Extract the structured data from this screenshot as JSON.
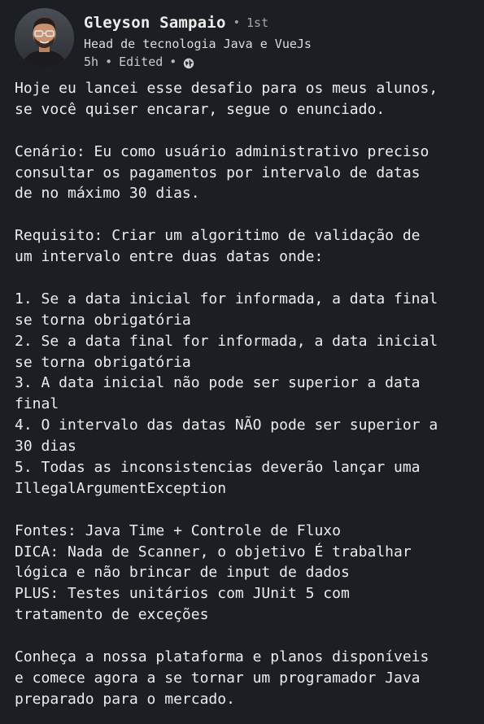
{
  "author": {
    "name": "Gleyson Sampaio",
    "degree": "1st",
    "headline": "Head de tecnologia Java e VueJs",
    "time": "5h",
    "edited": "Edited",
    "visibility_icon": "globe-icon"
  },
  "post": {
    "lines": [
      "Hoje eu lancei esse desafio para os meus alunos,",
      "se você quiser encarar, segue o enunciado.",
      "",
      "Cenário: Eu como usuário administrativo preciso",
      "consultar os pagamentos por intervalo de datas",
      "de no máximo 30 dias.",
      "",
      "Requisito: Criar um algoritimo de validação de",
      "um intervalo entre duas datas onde:",
      "",
      "1. Se a data inicial for informada, a data final",
      "se torna obrigatória",
      "2. Se a data final for informada, a data inicial",
      "se torna obrigatória",
      "3. A data inicial não pode ser superior a data",
      "final",
      "4. O intervalo das datas NÃO pode ser superior a",
      "30 dias",
      "5. Todas as inconsistencias deverão lançar uma",
      "IllegalArgumentException",
      "",
      "Fontes: Java Time + Controle de Fluxo",
      "DICA: Nada de Scanner, o objetivo É trabalhar",
      "lógica e não brincar de input de dados",
      "PLUS: Testes unitários com JUnit 5 com",
      "tratamento de exceções",
      "",
      "Conheça a nossa plataforma e planos disponíveis",
      "e comece agora a se tornar um programador Java",
      "preparado para o mercado."
    ]
  }
}
